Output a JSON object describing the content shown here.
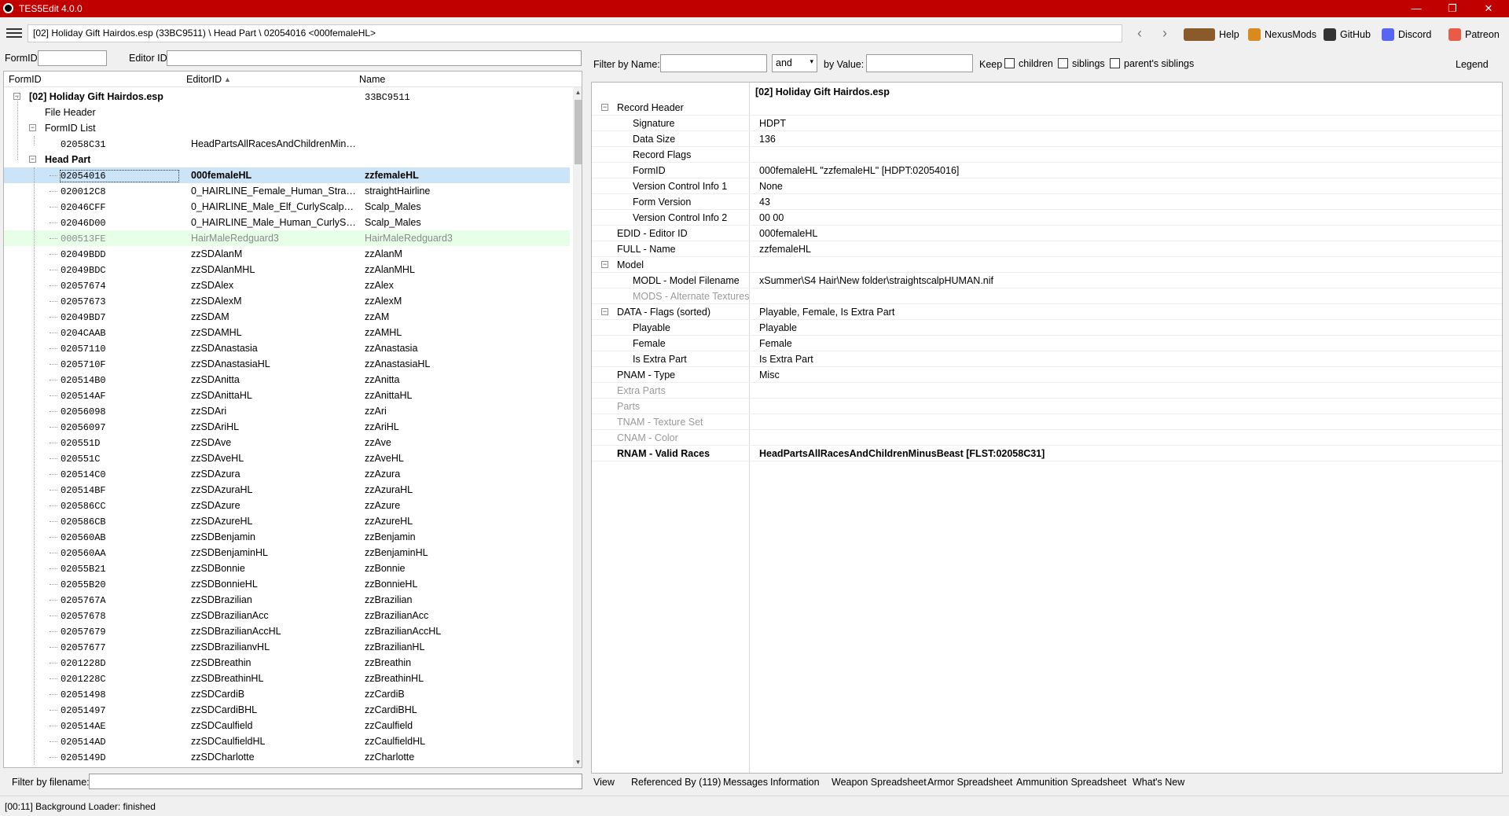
{
  "window": {
    "title": "TES5Edit 4.0.0",
    "minimize": "—",
    "restore": "❐",
    "close": "✕"
  },
  "toolbar": {
    "path": "[02] Holiday Gift Hairdos.esp (33BC9511) \\ Head Part \\ 02054016 <000femaleHL>",
    "back": "‹",
    "forward": "›",
    "links": [
      {
        "label": "Help",
        "icon": "book-icon",
        "color": "#8a5a2b"
      },
      {
        "label": "NexusMods",
        "icon": "nexusmods-icon",
        "color": "#d98a1e"
      },
      {
        "label": "GitHub",
        "icon": "github-icon",
        "color": "#333333"
      },
      {
        "label": "Discord",
        "icon": "discord-icon",
        "color": "#5865f2"
      },
      {
        "label": "Patreon",
        "icon": "patreon-icon",
        "color": "#e85b46"
      }
    ]
  },
  "left_filter": {
    "formid_label": "FormID",
    "editorid_label": "Editor ID",
    "formid_value": "",
    "editorid_value": ""
  },
  "tree": {
    "columns": [
      "FormID",
      "EditorID",
      "Name"
    ],
    "sort_indicator": "▲",
    "file": {
      "label": "[02] Holiday Gift Hairdos.esp",
      "name": "33BC9511"
    },
    "file_header": "File Header",
    "formid_list": "FormID List",
    "formid_list_item": {
      "id": "02058C31",
      "editor": "HeadPartsAllRacesAndChildrenMinusBeast"
    },
    "head_part": "Head Part",
    "rows": [
      {
        "id": "02054016",
        "editor": "000femaleHL",
        "name": "zzfemaleHL"
      },
      {
        "id": "020012C8",
        "editor": "0_HAIRLINE_Female_Human_Straigh...",
        "name": "straightHairline"
      },
      {
        "id": "02046CFF",
        "editor": "0_HAIRLINE_Male_Elf_CurlyScalpDU...",
        "name": "Scalp_Males"
      },
      {
        "id": "02046D00",
        "editor": "0_HAIRLINE_Male_Human_CurlyScal...",
        "name": "Scalp_Males"
      },
      {
        "id": "000513FE",
        "editor": "HairMaleRedguard3",
        "name": "HairMaleRedguard3"
      },
      {
        "id": "02049BDD",
        "editor": "zzSDAlanM",
        "name": "zzAlanM"
      },
      {
        "id": "02049BDC",
        "editor": "zzSDAlanMHL",
        "name": "zzAlanMHL"
      },
      {
        "id": "02057674",
        "editor": "zzSDAlex",
        "name": "zzAlex"
      },
      {
        "id": "02057673",
        "editor": "zzSDAlexM",
        "name": "zzAlexM"
      },
      {
        "id": "02049BD7",
        "editor": "zzSDAM",
        "name": "zzAM"
      },
      {
        "id": "0204CAAB",
        "editor": "zzSDAMHL",
        "name": "zzAMHL"
      },
      {
        "id": "02057110",
        "editor": "zzSDAnastasia",
        "name": "zzAnastasia"
      },
      {
        "id": "0205710F",
        "editor": "zzSDAnastasiaHL",
        "name": "zzAnastasiaHL"
      },
      {
        "id": "020514B0",
        "editor": "zzSDAnitta",
        "name": "zzAnitta"
      },
      {
        "id": "020514AF",
        "editor": "zzSDAnittaHL",
        "name": "zzAnittaHL"
      },
      {
        "id": "02056098",
        "editor": "zzSDAri",
        "name": "zzAri"
      },
      {
        "id": "02056097",
        "editor": "zzSDAriHL",
        "name": "zzAriHL"
      },
      {
        "id": "020551D",
        "editor": "zzSDAve",
        "name": "zzAve"
      },
      {
        "id": "020551C",
        "editor": "zzSDAveHL",
        "name": "zzAveHL"
      },
      {
        "id": "020514C0",
        "editor": "zzSDAzura",
        "name": "zzAzura"
      },
      {
        "id": "020514BF",
        "editor": "zzSDAzuraHL",
        "name": "zzAzuraHL"
      },
      {
        "id": "020586CC",
        "editor": "zzSDAzure",
        "name": "zzAzure"
      },
      {
        "id": "020586CB",
        "editor": "zzSDAzureHL",
        "name": "zzAzureHL"
      },
      {
        "id": "020560AB",
        "editor": "zzSDBenjamin",
        "name": "zzBenjamin"
      },
      {
        "id": "020560AA",
        "editor": "zzSDBenjaminHL",
        "name": "zzBenjaminHL"
      },
      {
        "id": "02055B21",
        "editor": "zzSDBonnie",
        "name": "zzBonnie"
      },
      {
        "id": "02055B20",
        "editor": "zzSDBonnieHL",
        "name": "zzBonnieHL"
      },
      {
        "id": "0205767A",
        "editor": "zzSDBrazilian",
        "name": "zzBrazilian"
      },
      {
        "id": "02057678",
        "editor": "zzSDBrazilianAcc",
        "name": "zzBrazilianAcc"
      },
      {
        "id": "02057679",
        "editor": "zzSDBrazilianAccHL",
        "name": "zzBrazilianAccHL"
      },
      {
        "id": "02057677",
        "editor": "zzSDBrazilianvHL",
        "name": "zzBrazilianHL"
      },
      {
        "id": "0201228D",
        "editor": "zzSDBreathin",
        "name": "zzBreathin"
      },
      {
        "id": "0201228C",
        "editor": "zzSDBreathinHL",
        "name": "zzBreathinHL"
      },
      {
        "id": "02051498",
        "editor": "zzSDCardiB",
        "name": "zzCardiB"
      },
      {
        "id": "02051497",
        "editor": "zzSDCardiBHL",
        "name": "zzCardiBHL"
      },
      {
        "id": "020514AE",
        "editor": "zzSDCaulfield",
        "name": "zzCaulfield"
      },
      {
        "id": "020514AD",
        "editor": "zzSDCaulfieldHL",
        "name": "zzCaulfieldHL"
      },
      {
        "id": "0205149D",
        "editor": "zzSDCharlotte",
        "name": "zzCharlotte"
      }
    ]
  },
  "file_filter": {
    "label": "Filter by filename:",
    "value": ""
  },
  "right_filter": {
    "name_label": "Filter by Name:",
    "name_value": "",
    "op_value": "and",
    "value_label": "by Value:",
    "value_value": "",
    "keep_label": "Keep",
    "children": "children",
    "siblings": "siblings",
    "parents_siblings": "parent's siblings",
    "legend": "Legend"
  },
  "detail": {
    "header": "[02] Holiday Gift Hairdos.esp",
    "rows": [
      {
        "key": "Record Header",
        "value": "",
        "indent": 1,
        "expand": true,
        "style": ""
      },
      {
        "key": "Signature",
        "value": "HDPT",
        "indent": 2,
        "style": ""
      },
      {
        "key": "Data Size",
        "value": "136",
        "indent": 2,
        "style": ""
      },
      {
        "key": "Record Flags",
        "value": "",
        "indent": 2,
        "style": ""
      },
      {
        "key": "FormID",
        "value": "000femaleHL \"zzfemaleHL\" [HDPT:02054016]",
        "indent": 2,
        "style": ""
      },
      {
        "key": "Version Control Info 1",
        "value": "None",
        "indent": 2,
        "style": ""
      },
      {
        "key": "Form Version",
        "value": "43",
        "indent": 2,
        "style": ""
      },
      {
        "key": "Version Control Info 2",
        "value": "00 00",
        "indent": 2,
        "style": ""
      },
      {
        "key": "EDID - Editor ID",
        "value": "000femaleHL",
        "indent": 1,
        "style": ""
      },
      {
        "key": "FULL - Name",
        "value": "zzfemaleHL",
        "indent": 1,
        "style": ""
      },
      {
        "key": "Model",
        "value": "",
        "indent": 1,
        "expand": true,
        "style": ""
      },
      {
        "key": "MODL - Model Filename",
        "value": "xSummer\\S4 Hair\\New folder\\straightscalpHUMAN.nif",
        "indent": 2,
        "style": ""
      },
      {
        "key": "MODS - Alternate Textures",
        "value": "",
        "indent": 2,
        "style": "gray"
      },
      {
        "key": "DATA - Flags (sorted)",
        "value": "Playable, Female, Is Extra Part",
        "indent": 1,
        "expand": true,
        "style": ""
      },
      {
        "key": "Playable",
        "value": "Playable",
        "indent": 2,
        "style": ""
      },
      {
        "key": "Female",
        "value": "Female",
        "indent": 2,
        "style": ""
      },
      {
        "key": "Is Extra Part",
        "value": "Is Extra Part",
        "indent": 2,
        "style": ""
      },
      {
        "key": "PNAM - Type",
        "value": "Misc",
        "indent": 1,
        "style": ""
      },
      {
        "key": "Extra Parts",
        "value": "",
        "indent": 1,
        "style": "gray"
      },
      {
        "key": "Parts",
        "value": "",
        "indent": 1,
        "style": "gray"
      },
      {
        "key": "TNAM - Texture Set",
        "value": "",
        "indent": 1,
        "style": "gray"
      },
      {
        "key": "CNAM - Color",
        "value": "",
        "indent": 1,
        "style": "gray"
      },
      {
        "key": "RNAM - Valid Races",
        "value": "HeadPartsAllRacesAndChildrenMinusBeast [FLST:02058C31]",
        "indent": 1,
        "style": "bold"
      }
    ]
  },
  "tabs": [
    "View",
    "Referenced By (119)",
    "Messages",
    "Information",
    "Weapon Spreadsheet",
    "Armor Spreadsheet",
    "Ammunition Spreadsheet",
    "What's New"
  ],
  "status": "[00:11] Background Loader: finished"
}
